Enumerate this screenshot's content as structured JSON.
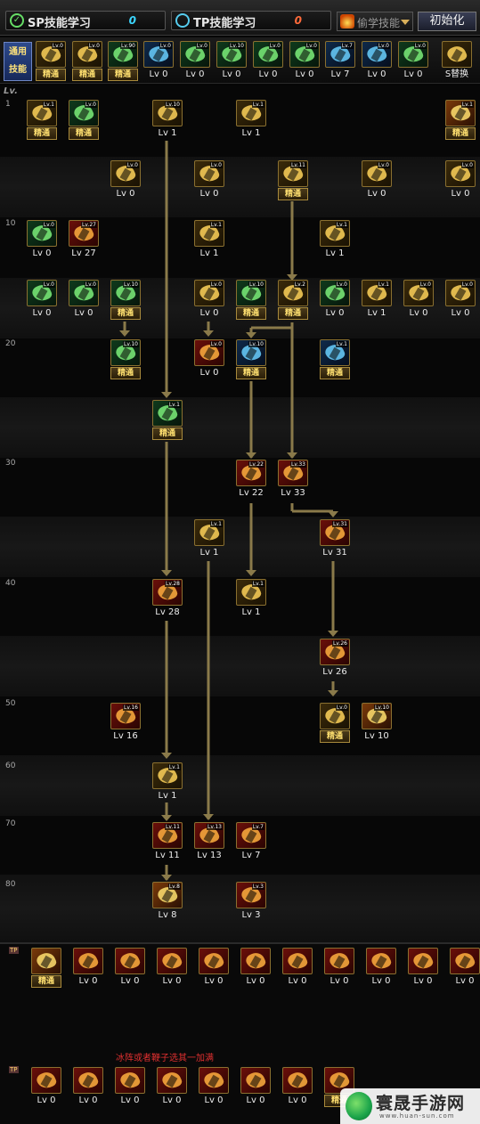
{
  "header": {
    "sp_label": "SP技能学习",
    "sp_value": "0",
    "tp_label": "TP技能学习",
    "tp_value": "0",
    "dropdown_label": "偷学技能",
    "init_button": "初始化"
  },
  "common": {
    "label_line1": "通用",
    "label_line2": "技能",
    "skills": [
      {
        "lv": "Lv.0",
        "label": "精通",
        "color": "gold"
      },
      {
        "lv": "Lv.0",
        "label": "精通",
        "color": "gold"
      },
      {
        "lv": "Lv.90",
        "label": "精通",
        "color": "green"
      },
      {
        "lv": "Lv.0",
        "label": "Lv 0",
        "color": "blue"
      },
      {
        "lv": "Lv.0",
        "label": "Lv 0",
        "color": "green"
      },
      {
        "lv": "Lv.10",
        "label": "Lv 0",
        "color": "green"
      },
      {
        "lv": "Lv.0",
        "label": "Lv 0",
        "color": "green"
      },
      {
        "lv": "Lv.0",
        "label": "Lv 0",
        "color": "green"
      },
      {
        "lv": "Lv.7",
        "label": "Lv 7",
        "color": "blue"
      },
      {
        "lv": "Lv.0",
        "label": "Lv 0",
        "color": "blue"
      },
      {
        "lv": "Lv.0",
        "label": "Lv 0",
        "color": "green"
      },
      {
        "lv": "",
        "label": "S替换",
        "color": "gold"
      }
    ]
  },
  "levels": {
    "header": "Lv.",
    "marks": [
      "1",
      "10",
      "20",
      "30",
      "40",
      "50",
      "60",
      "70",
      "80"
    ]
  },
  "skills": [
    {
      "lv": "Lv.1",
      "label": "精通",
      "color": "gold"
    },
    {
      "lv": "Lv.0",
      "label": "精通",
      "color": "green"
    },
    {
      "lv": "Lv.10",
      "label": "Lv 1",
      "color": "gold"
    },
    {
      "lv": "Lv.1",
      "label": "Lv 1",
      "color": "gold"
    },
    {
      "lv": "Lv.1",
      "label": "精通",
      "color": "orange"
    },
    {
      "lv": "Lv.0",
      "label": "Lv 0",
      "color": "gold"
    },
    {
      "lv": "Lv.0",
      "label": "Lv 0",
      "color": "gold"
    },
    {
      "lv": "Lv.11",
      "label": "精通",
      "color": "gold"
    },
    {
      "lv": "Lv.0",
      "label": "Lv 0",
      "color": "gold"
    },
    {
      "lv": "Lv.0",
      "label": "Lv 0",
      "color": "gold"
    },
    {
      "lv": "Lv.0",
      "label": "Lv 0",
      "color": "green"
    },
    {
      "lv": "Lv.27",
      "label": "Lv 27",
      "color": "red"
    },
    {
      "lv": "Lv.1",
      "label": "Lv 1",
      "color": "gold"
    },
    {
      "lv": "Lv.1",
      "label": "Lv 1",
      "color": "gold"
    },
    {
      "lv": "Lv.0",
      "label": "Lv 0",
      "color": "green"
    },
    {
      "lv": "Lv.0",
      "label": "Lv 0",
      "color": "green"
    },
    {
      "lv": "Lv.10",
      "label": "精通",
      "color": "green"
    },
    {
      "lv": "Lv.0",
      "label": "Lv 0",
      "color": "gold"
    },
    {
      "lv": "Lv.10",
      "label": "精通",
      "color": "green"
    },
    {
      "lv": "Lv.2",
      "label": "精通",
      "color": "gold"
    },
    {
      "lv": "Lv.0",
      "label": "Lv 0",
      "color": "green"
    },
    {
      "lv": "Lv.1",
      "label": "Lv 1",
      "color": "gold"
    },
    {
      "lv": "Lv.0",
      "label": "Lv 0",
      "color": "gold"
    },
    {
      "lv": "Lv.0",
      "label": "Lv 0",
      "color": "gold"
    },
    {
      "lv": "Lv.10",
      "label": "精通",
      "color": "green"
    },
    {
      "lv": "Lv.0",
      "label": "Lv 0",
      "color": "red"
    },
    {
      "lv": "Lv.10",
      "label": "精通",
      "color": "blue"
    },
    {
      "lv": "Lv.1",
      "label": "精通",
      "color": "blue"
    },
    {
      "lv": "Lv.1",
      "label": "精通",
      "color": "green"
    },
    {
      "lv": "Lv.22",
      "label": "Lv 22",
      "color": "red"
    },
    {
      "lv": "Lv.33",
      "label": "Lv 33",
      "color": "red"
    },
    {
      "lv": "Lv.1",
      "label": "Lv 1",
      "color": "gold"
    },
    {
      "lv": "Lv.31",
      "label": "Lv 31",
      "color": "red"
    },
    {
      "lv": "Lv.28",
      "label": "Lv 28",
      "color": "red"
    },
    {
      "lv": "Lv.1",
      "label": "Lv 1",
      "color": "gold"
    },
    {
      "lv": "Lv.26",
      "label": "Lv 26",
      "color": "red"
    },
    {
      "lv": "Lv.16",
      "label": "Lv 16",
      "color": "red"
    },
    {
      "lv": "Lv.0",
      "label": "精通",
      "color": "gold"
    },
    {
      "lv": "Lv.10",
      "label": "Lv 10",
      "color": "orange"
    },
    {
      "lv": "Lv.1",
      "label": "Lv 1",
      "color": "gold"
    },
    {
      "lv": "Lv.11",
      "label": "Lv 11",
      "color": "red"
    },
    {
      "lv": "Lv.13",
      "label": "Lv 13",
      "color": "red"
    },
    {
      "lv": "Lv.7",
      "label": "Lv 7",
      "color": "red"
    },
    {
      "lv": "Lv.8",
      "label": "Lv 8",
      "color": "orange"
    },
    {
      "lv": "Lv.3",
      "label": "Lv 3",
      "color": "red"
    }
  ],
  "bottom": {
    "tp_tag": "TP",
    "note": "冰阵或者鞭子选其一加满",
    "row1": [
      {
        "label": "精通",
        "color": "orange"
      },
      {
        "label": "Lv 0",
        "color": "red"
      },
      {
        "label": "Lv 0",
        "color": "red"
      },
      {
        "label": "Lv 0",
        "color": "red"
      },
      {
        "label": "Lv 0",
        "color": "red"
      },
      {
        "label": "Lv 0",
        "color": "red"
      },
      {
        "label": "Lv 0",
        "color": "red"
      },
      {
        "label": "Lv 0",
        "color": "red"
      },
      {
        "label": "Lv 0",
        "color": "red"
      },
      {
        "label": "Lv 0",
        "color": "red"
      },
      {
        "label": "Lv 0",
        "color": "red"
      }
    ],
    "row2": [
      {
        "label": "Lv 0",
        "color": "red"
      },
      {
        "label": "Lv 0",
        "color": "red"
      },
      {
        "label": "Lv 0",
        "color": "red"
      },
      {
        "label": "Lv 0",
        "color": "red"
      },
      {
        "label": "Lv 0",
        "color": "red"
      },
      {
        "label": "Lv 0",
        "color": "red"
      },
      {
        "label": "Lv 0",
        "color": "red"
      },
      {
        "label": "精通",
        "color": "red"
      }
    ]
  },
  "watermark": {
    "name": "寰晟手游网",
    "url": "www.huan-sun.com"
  }
}
